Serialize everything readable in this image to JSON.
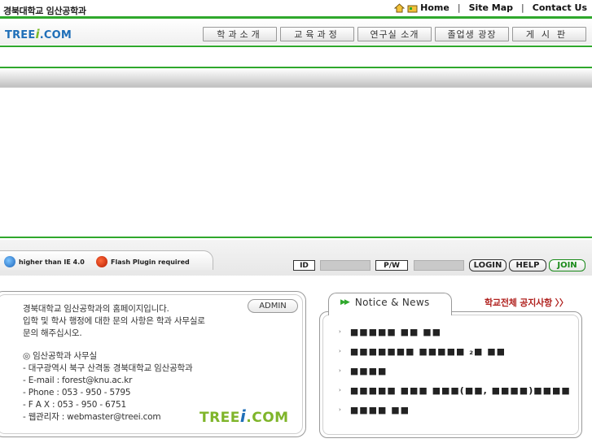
{
  "header": {
    "university": "경북대학교 임산공학과",
    "links": [
      {
        "label": "Home",
        "icon": "home-icon"
      },
      {
        "label": "Site Map",
        "icon": ""
      },
      {
        "label": "Contact Us",
        "icon": ""
      }
    ],
    "separator": "|"
  },
  "logo": {
    "prefix": "TREE",
    "mark": "i",
    "suffix": ".COM"
  },
  "nav": {
    "items": [
      "학과소개",
      "교육과정",
      "연구실 소개",
      "졸업생 광장",
      "게시판"
    ]
  },
  "requirements": {
    "ie": "higher than IE 4.0",
    "flash": "Flash Plugin required"
  },
  "login": {
    "id_label": "ID",
    "pw_label": "P/W",
    "login_button": "LOGIN",
    "help_button": "HELP",
    "join_button": "JOIN"
  },
  "info": {
    "admin_button": "ADMIN",
    "welcome_lines": [
      "경북대학교 임산공학과의 홈페이지입니다.",
      "입학 및 학사 행정에 대한 문의 사항은 학과 사무실로",
      "문의 해주십시오."
    ],
    "office_title": "◎ 임산공학과 사무실",
    "address": "- 대구광역시 북구 산격동 경북대학교 임산공학과",
    "email": "- E-mail : forest@knu.ac.kr",
    "phone": "- Phone : 053 - 950 - 5795",
    "fax": "- F A X : 053 - 950 - 6751",
    "webmaster": "- 웹관리자 : webmaster@treei.com"
  },
  "notice": {
    "title": "Notice & News",
    "all_link": "학교전체 공지사항 〉〉",
    "items": [
      "■■■■■ ■■ ■■",
      "■■■■■■■ ■■■■■ ₂■ ■■",
      "■■■■",
      "■■■■■ ■■■ ■■■(■■, ■■■■)■■■■",
      "■■■■ ■■"
    ]
  },
  "colors": {
    "accent_green": "#2fa82c",
    "logo_blue": "#1f6fb8",
    "notice_red": "#b0201d"
  }
}
